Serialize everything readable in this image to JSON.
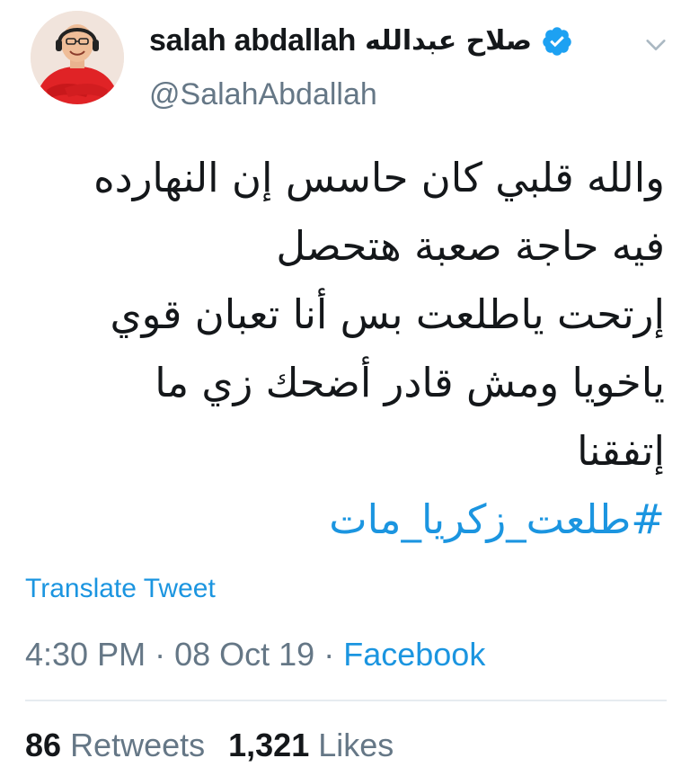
{
  "user": {
    "display_name_latin": "salah abdallah",
    "display_name_arabic": "صلاح عبدالله",
    "handle": "@SalahAbdallah",
    "verified": true,
    "avatar_icon": "profile-photo"
  },
  "tweet": {
    "lines": [
      "والله قلبي كان حاسس إن النهارده",
      "فيه حاجة صعبة هتحصل",
      "إرتحت ياطلعت بس أنا تعبان قوي",
      "ياخويا ومش قادر أضحك زي ما",
      "إتفقنا"
    ],
    "hashtag": "#طلعت_زكريا_مات",
    "translate_label": "Translate Tweet",
    "time": "4:30 PM",
    "separator": "·",
    "date": "08 Oct 19",
    "source": "Facebook"
  },
  "stats": {
    "retweets_count": "86",
    "retweets_label": "Retweets",
    "likes_count": "1,321",
    "likes_label": "Likes"
  },
  "colors": {
    "link": "#1b95e0",
    "secondary_text": "#657786",
    "primary_text": "#14171a",
    "verified_badge": "#1da1f2",
    "divider": "#e6ecf0"
  }
}
